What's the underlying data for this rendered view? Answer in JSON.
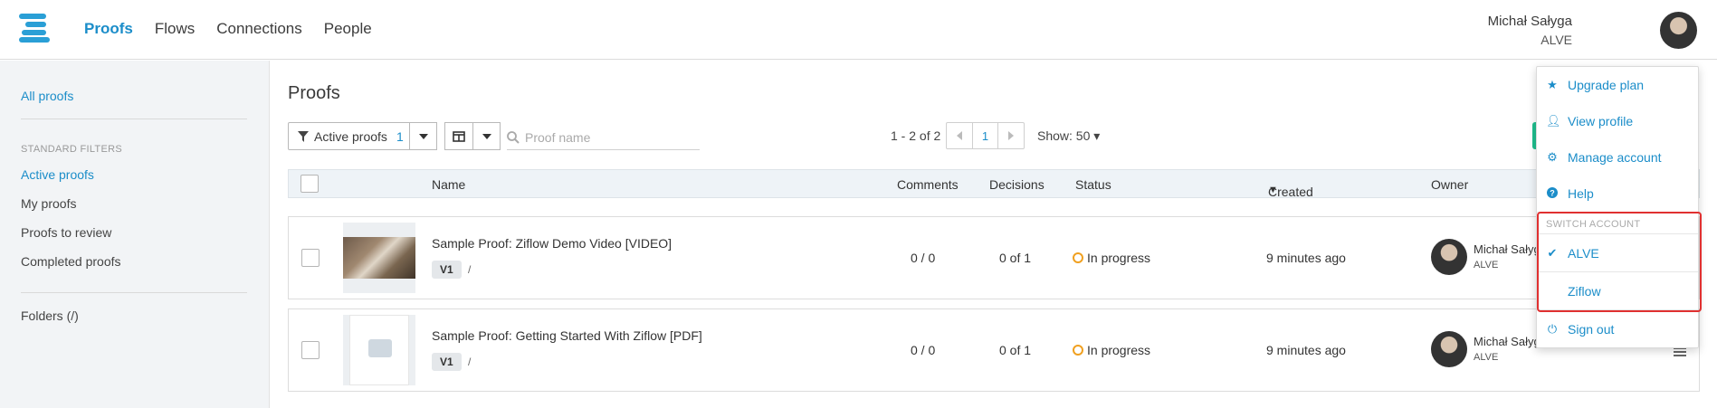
{
  "nav": {
    "items": [
      "Proofs",
      "Flows",
      "Connections",
      "People"
    ],
    "active": "Proofs"
  },
  "user": {
    "name": "Michał Sałyga",
    "org": "ALVE"
  },
  "sidebar": {
    "all_proofs": "All proofs",
    "filters_heading": "STANDARD FILTERS",
    "filters": [
      "Active proofs",
      "My proofs",
      "Proofs to review",
      "Completed proofs"
    ],
    "folders": "Folders (/)"
  },
  "main": {
    "title": "Proofs",
    "filter_label": "Active proofs",
    "filter_count": "1",
    "search_placeholder": "Proof name",
    "pager_text": "1 - 2 of 2",
    "page": "1",
    "show": "Show: 50"
  },
  "table": {
    "headers": {
      "name": "Name",
      "comments": "Comments",
      "decisions": "Decisions",
      "status": "Status",
      "created": "Created",
      "owner": "Owner"
    },
    "rows": [
      {
        "name": "Sample Proof: Ziflow Demo Video [VIDEO]",
        "version": "V1",
        "path": "/",
        "comments": "0 / 0",
        "decisions": "0 of 1",
        "status": "In progress",
        "created": "9 minutes ago",
        "owner": "Michał Sałyg",
        "owner_org": "ALVE"
      },
      {
        "name": "Sample Proof: Getting Started With Ziflow [PDF]",
        "version": "V1",
        "path": "/",
        "comments": "0 / 0",
        "decisions": "0 of 1",
        "status": "In progress",
        "created": "9 minutes ago",
        "owner": "Michał Sałyg",
        "owner_org": "ALVE"
      }
    ]
  },
  "dropdown": {
    "upgrade": "Upgrade plan",
    "view_profile": "View profile",
    "manage_account": "Manage account",
    "help": "Help",
    "switch_heading": "SWITCH ACCOUNT",
    "accounts": [
      "ALVE",
      "Ziflow"
    ],
    "sign_out": "Sign out"
  },
  "colors": {
    "accent": "#1b8dc9",
    "status": "#f0a020",
    "highlight": "#e03030"
  }
}
